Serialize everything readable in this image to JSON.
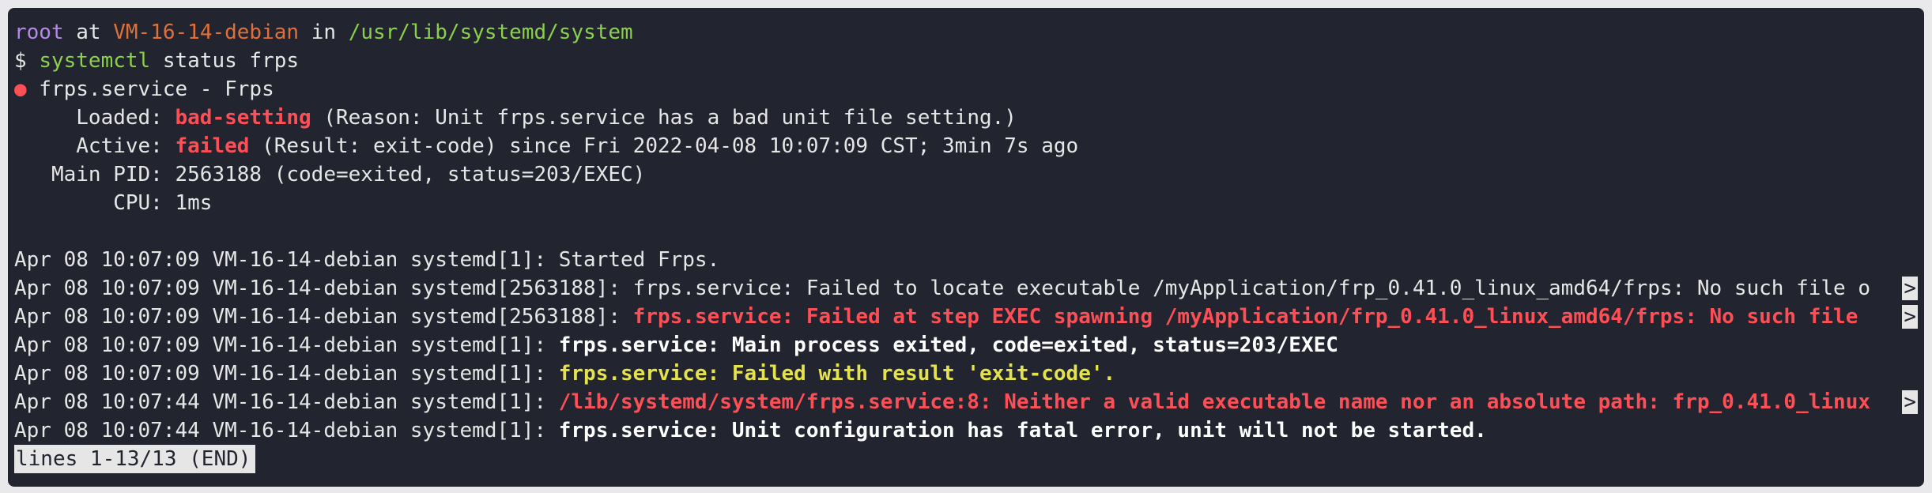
{
  "prompt": {
    "user": "root",
    "at": "at",
    "host": "VM-16-14-debian",
    "in": "in",
    "cwd": "/usr/lib/systemd/system"
  },
  "command": {
    "symbol": "$",
    "program": "systemctl",
    "args": "status frps"
  },
  "service": {
    "bullet": "●",
    "name": " frps.service - Frps",
    "loaded_label": "     Loaded: ",
    "loaded_state": "bad-setting",
    "loaded_reason": " (Reason: Unit frps.service has a bad unit file setting.)",
    "active_label": "     Active: ",
    "active_state": "failed",
    "active_detail": " (Result: exit-code) since Fri 2022-04-08 10:07:09 CST; 3min 7s ago",
    "main_pid": "   Main PID: 2563188 (code=exited, status=203/EXEC)",
    "cpu": "        CPU: 1ms"
  },
  "logs": [
    {
      "prefix": "Apr 08 10:07:09 VM-16-14-debian systemd[1]: ",
      "message": "Started Frps."
    },
    {
      "prefix": "Apr 08 10:07:09 VM-16-14-debian systemd[2563188]: ",
      "message": "frps.service: Failed to locate executable /myApplication/frp_0.41.0_linux_amd64/frps: No such file o"
    },
    {
      "prefix": "Apr 08 10:07:09 VM-16-14-debian systemd[2563188]: ",
      "message": "frps.service: Failed at step EXEC spawning /myApplication/frp_0.41.0_linux_amd64/frps: No such file "
    },
    {
      "prefix": "Apr 08 10:07:09 VM-16-14-debian systemd[1]: ",
      "message": "frps.service: Main process exited, code=exited, status=203/EXEC"
    },
    {
      "prefix": "Apr 08 10:07:09 VM-16-14-debian systemd[1]: ",
      "message": "frps.service: Failed with result 'exit-code'."
    },
    {
      "prefix": "Apr 08 10:07:44 VM-16-14-debian systemd[1]: ",
      "message": "/lib/systemd/system/frps.service:8: Neither a valid executable name nor an absolute path: frp_0.41.0_linux"
    },
    {
      "prefix": "Apr 08 10:07:44 VM-16-14-debian systemd[1]: ",
      "message": "frps.service: Unit configuration has fatal error, unit will not be started."
    }
  ],
  "overflow_marker": ">",
  "pager_status": "lines 1-13/13 (END)",
  "colors": {
    "background": "#22252f",
    "user": "#b48ae8",
    "host": "#e0703a",
    "path": "#8ad04a",
    "error": "#ff4f56",
    "warning": "#e4e34d"
  }
}
